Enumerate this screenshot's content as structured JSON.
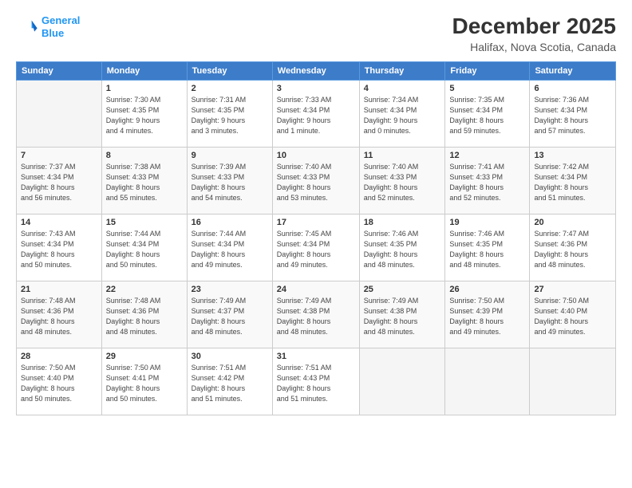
{
  "header": {
    "logo_line1": "General",
    "logo_line2": "Blue",
    "title": "December 2025",
    "subtitle": "Halifax, Nova Scotia, Canada"
  },
  "calendar": {
    "columns": [
      "Sunday",
      "Monday",
      "Tuesday",
      "Wednesday",
      "Thursday",
      "Friday",
      "Saturday"
    ],
    "weeks": [
      [
        {
          "day": "",
          "info": ""
        },
        {
          "day": "1",
          "info": "Sunrise: 7:30 AM\nSunset: 4:35 PM\nDaylight: 9 hours\nand 4 minutes."
        },
        {
          "day": "2",
          "info": "Sunrise: 7:31 AM\nSunset: 4:35 PM\nDaylight: 9 hours\nand 3 minutes."
        },
        {
          "day": "3",
          "info": "Sunrise: 7:33 AM\nSunset: 4:34 PM\nDaylight: 9 hours\nand 1 minute."
        },
        {
          "day": "4",
          "info": "Sunrise: 7:34 AM\nSunset: 4:34 PM\nDaylight: 9 hours\nand 0 minutes."
        },
        {
          "day": "5",
          "info": "Sunrise: 7:35 AM\nSunset: 4:34 PM\nDaylight: 8 hours\nand 59 minutes."
        },
        {
          "day": "6",
          "info": "Sunrise: 7:36 AM\nSunset: 4:34 PM\nDaylight: 8 hours\nand 57 minutes."
        }
      ],
      [
        {
          "day": "7",
          "info": "Sunrise: 7:37 AM\nSunset: 4:34 PM\nDaylight: 8 hours\nand 56 minutes."
        },
        {
          "day": "8",
          "info": "Sunrise: 7:38 AM\nSunset: 4:33 PM\nDaylight: 8 hours\nand 55 minutes."
        },
        {
          "day": "9",
          "info": "Sunrise: 7:39 AM\nSunset: 4:33 PM\nDaylight: 8 hours\nand 54 minutes."
        },
        {
          "day": "10",
          "info": "Sunrise: 7:40 AM\nSunset: 4:33 PM\nDaylight: 8 hours\nand 53 minutes."
        },
        {
          "day": "11",
          "info": "Sunrise: 7:40 AM\nSunset: 4:33 PM\nDaylight: 8 hours\nand 52 minutes."
        },
        {
          "day": "12",
          "info": "Sunrise: 7:41 AM\nSunset: 4:33 PM\nDaylight: 8 hours\nand 52 minutes."
        },
        {
          "day": "13",
          "info": "Sunrise: 7:42 AM\nSunset: 4:34 PM\nDaylight: 8 hours\nand 51 minutes."
        }
      ],
      [
        {
          "day": "14",
          "info": "Sunrise: 7:43 AM\nSunset: 4:34 PM\nDaylight: 8 hours\nand 50 minutes."
        },
        {
          "day": "15",
          "info": "Sunrise: 7:44 AM\nSunset: 4:34 PM\nDaylight: 8 hours\nand 50 minutes."
        },
        {
          "day": "16",
          "info": "Sunrise: 7:44 AM\nSunset: 4:34 PM\nDaylight: 8 hours\nand 49 minutes."
        },
        {
          "day": "17",
          "info": "Sunrise: 7:45 AM\nSunset: 4:34 PM\nDaylight: 8 hours\nand 49 minutes."
        },
        {
          "day": "18",
          "info": "Sunrise: 7:46 AM\nSunset: 4:35 PM\nDaylight: 8 hours\nand 48 minutes."
        },
        {
          "day": "19",
          "info": "Sunrise: 7:46 AM\nSunset: 4:35 PM\nDaylight: 8 hours\nand 48 minutes."
        },
        {
          "day": "20",
          "info": "Sunrise: 7:47 AM\nSunset: 4:36 PM\nDaylight: 8 hours\nand 48 minutes."
        }
      ],
      [
        {
          "day": "21",
          "info": "Sunrise: 7:48 AM\nSunset: 4:36 PM\nDaylight: 8 hours\nand 48 minutes."
        },
        {
          "day": "22",
          "info": "Sunrise: 7:48 AM\nSunset: 4:36 PM\nDaylight: 8 hours\nand 48 minutes."
        },
        {
          "day": "23",
          "info": "Sunrise: 7:49 AM\nSunset: 4:37 PM\nDaylight: 8 hours\nand 48 minutes."
        },
        {
          "day": "24",
          "info": "Sunrise: 7:49 AM\nSunset: 4:38 PM\nDaylight: 8 hours\nand 48 minutes."
        },
        {
          "day": "25",
          "info": "Sunrise: 7:49 AM\nSunset: 4:38 PM\nDaylight: 8 hours\nand 48 minutes."
        },
        {
          "day": "26",
          "info": "Sunrise: 7:50 AM\nSunset: 4:39 PM\nDaylight: 8 hours\nand 49 minutes."
        },
        {
          "day": "27",
          "info": "Sunrise: 7:50 AM\nSunset: 4:40 PM\nDaylight: 8 hours\nand 49 minutes."
        }
      ],
      [
        {
          "day": "28",
          "info": "Sunrise: 7:50 AM\nSunset: 4:40 PM\nDaylight: 8 hours\nand 50 minutes."
        },
        {
          "day": "29",
          "info": "Sunrise: 7:50 AM\nSunset: 4:41 PM\nDaylight: 8 hours\nand 50 minutes."
        },
        {
          "day": "30",
          "info": "Sunrise: 7:51 AM\nSunset: 4:42 PM\nDaylight: 8 hours\nand 51 minutes."
        },
        {
          "day": "31",
          "info": "Sunrise: 7:51 AM\nSunset: 4:43 PM\nDaylight: 8 hours\nand 51 minutes."
        },
        {
          "day": "",
          "info": ""
        },
        {
          "day": "",
          "info": ""
        },
        {
          "day": "",
          "info": ""
        }
      ]
    ]
  }
}
